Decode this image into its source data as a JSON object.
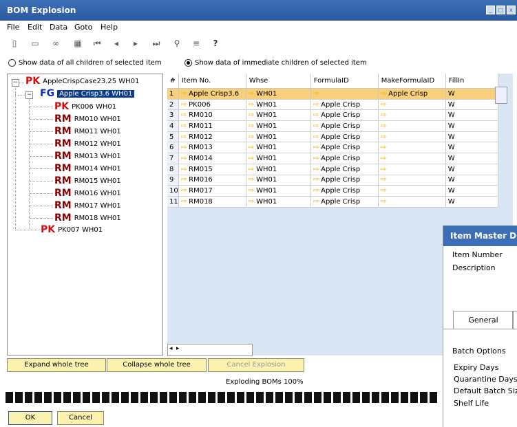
{
  "window": {
    "title": "BOM Explosion"
  },
  "menu": [
    "File",
    "Edit",
    "Data",
    "Goto",
    "Help"
  ],
  "toolbar_icons": [
    "preview-icon",
    "print-icon",
    "find-icon",
    "form-icon",
    "first-record-icon",
    "prev-record-icon",
    "next-record-icon",
    "last-record-icon",
    "link-icon",
    "list-icon",
    "help-icon"
  ],
  "options": {
    "all_children": "Show data of all children of selected item",
    "immediate_children": "Show data of immediate children of selected item",
    "selected": "immediate_children"
  },
  "tree": {
    "root": {
      "tag": "PK",
      "label": "AppleCrispCase23.25 WH01"
    },
    "fg": {
      "tag": "FG",
      "label": "Apple Crisp3.6 WH01"
    },
    "children": [
      {
        "tag": "PK",
        "label": "PK006 WH01"
      },
      {
        "tag": "RM",
        "label": "RM010 WH01"
      },
      {
        "tag": "RM",
        "label": "RM011 WH01"
      },
      {
        "tag": "RM",
        "label": "RM012 WH01"
      },
      {
        "tag": "RM",
        "label": "RM013 WH01"
      },
      {
        "tag": "RM",
        "label": "RM014 WH01"
      },
      {
        "tag": "RM",
        "label": "RM015 WH01"
      },
      {
        "tag": "RM",
        "label": "RM016 WH01"
      },
      {
        "tag": "RM",
        "label": "RM017 WH01"
      },
      {
        "tag": "RM",
        "label": "RM018 WH01"
      }
    ],
    "sibling": {
      "tag": "PK",
      "label": "PK007 WH01"
    }
  },
  "grid": {
    "columns": [
      "#",
      "Item No.",
      "Whse",
      "FormulaID",
      "MakeFormulaID",
      "FillIn"
    ],
    "rows": [
      [
        "1",
        "Apple Crisp3.6",
        "WH01",
        "",
        "Apple Crisp",
        "W"
      ],
      [
        "2",
        "PK006",
        "WH01",
        "Apple Crisp",
        "",
        "W"
      ],
      [
        "3",
        "RM010",
        "WH01",
        "Apple Crisp",
        "",
        "W"
      ],
      [
        "4",
        "RM011",
        "WH01",
        "Apple Crisp",
        "",
        "W"
      ],
      [
        "5",
        "RM012",
        "WH01",
        "Apple Crisp",
        "",
        "W"
      ],
      [
        "6",
        "RM013",
        "WH01",
        "Apple Crisp",
        "",
        "W"
      ],
      [
        "7",
        "RM014",
        "WH01",
        "Apple Crisp",
        "",
        "W"
      ],
      [
        "8",
        "RM015",
        "WH01",
        "Apple Crisp",
        "",
        "W"
      ],
      [
        "9",
        "RM016",
        "WH01",
        "Apple Crisp",
        "",
        "W"
      ],
      [
        "10",
        "RM017",
        "WH01",
        "Apple Crisp",
        "",
        "W"
      ],
      [
        "11",
        "RM018",
        "WH01",
        "Apple Crisp",
        "",
        "W"
      ]
    ]
  },
  "buttons": {
    "expand": "Expand whole tree",
    "collapse": "Collapse whole tree",
    "cancel_explosion": "Cancel Explosion",
    "ok": "OK",
    "cancel": "Cancel"
  },
  "status": "Exploding BOMs 100%",
  "progress": 1.0,
  "item_master": {
    "title": "Item Master D",
    "item_number_label": "Item Number",
    "description_label": "Description",
    "tab_general": "General",
    "batch_options": "Batch Options",
    "expiry_days": "Expiry Days",
    "quarantine_days": "Quarantine Days",
    "default_batch_size": "Default Batch Size",
    "shelf_life": "Shelf Life"
  },
  "colors": {
    "titlebar": "#3c6fb6",
    "selected_row": "#f8cf7a",
    "button": "#fbf2b0",
    "tree_selected": "#0b3c8a"
  }
}
